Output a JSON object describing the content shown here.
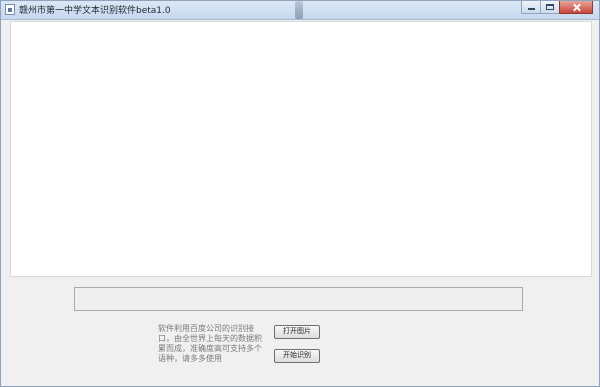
{
  "window": {
    "title": "赣州市第一中学文本识别软件beta1.0"
  },
  "result": {
    "value": ""
  },
  "info": {
    "text": "软件利用百度公司的识别接口，由全世界上每天的数据积累而成，准确度高可支持多个语种，请多多使用"
  },
  "buttons": {
    "open_image": "打开图片",
    "start_recognition": "开始识别"
  }
}
